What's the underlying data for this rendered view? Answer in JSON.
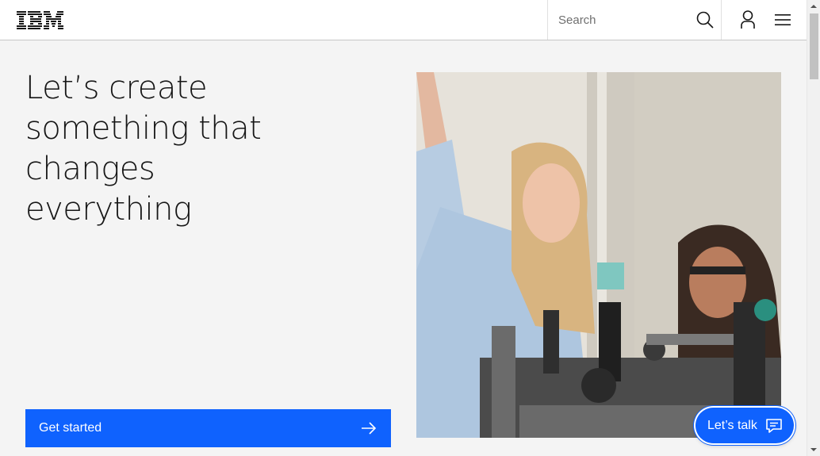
{
  "header": {
    "logo_text": "IBM",
    "search": {
      "placeholder": "Search",
      "value": ""
    }
  },
  "hero": {
    "title_lines": [
      "Let’s create",
      "something that",
      "changes",
      "everything"
    ],
    "cta_label": "Get started"
  },
  "chat": {
    "label": "Let’s talk"
  },
  "icons": {
    "search": "search-icon",
    "user": "user-icon",
    "menu": "menu-icon",
    "cta_arrow": "arrow-right-icon",
    "chat": "chat-icon"
  },
  "colors": {
    "accent": "#0f62fe",
    "background": "#f4f4f4",
    "header_bg": "#ffffff",
    "text": "#161616"
  }
}
